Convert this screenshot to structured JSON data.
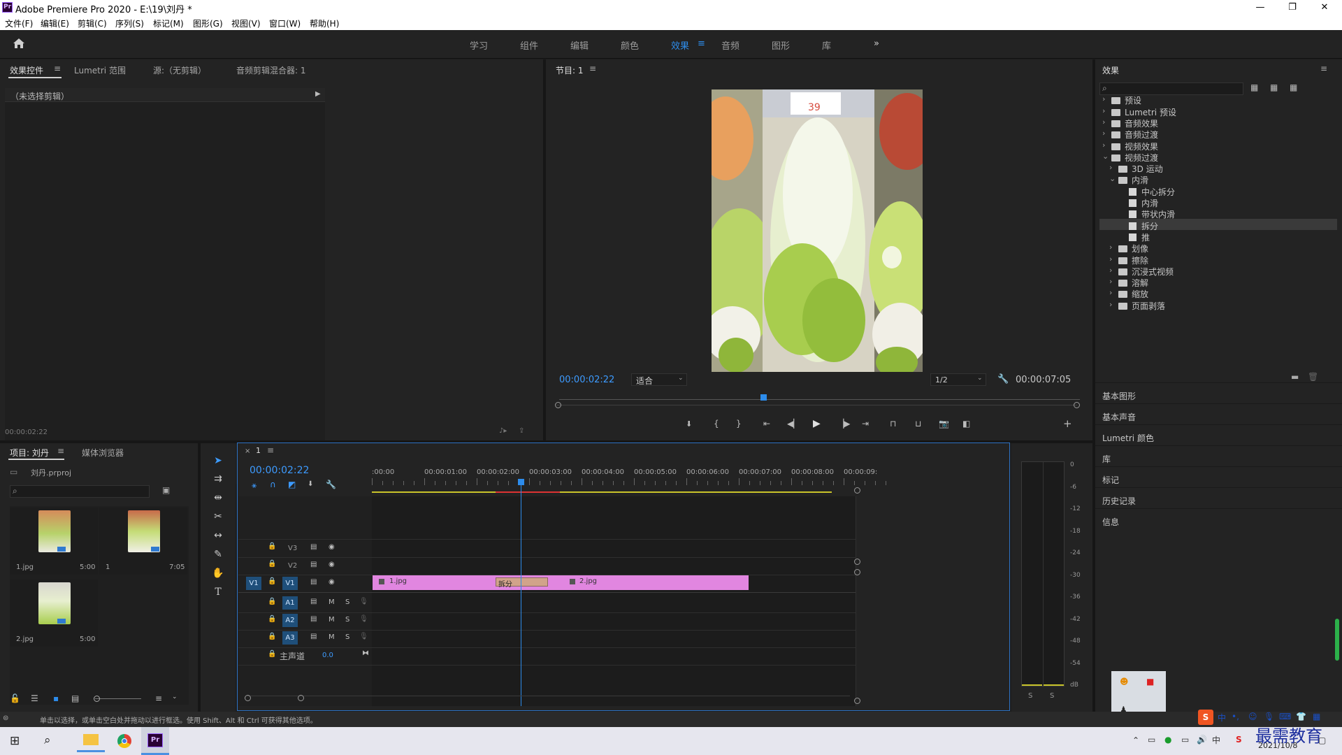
{
  "window": {
    "title": "Adobe Premiere Pro 2020 - E:\\19\\刘丹 *",
    "logo": "Pr",
    "controls": [
      "—",
      "❐",
      "✕"
    ]
  },
  "menu": [
    "文件(F)",
    "编辑(E)",
    "剪辑(C)",
    "序列(S)",
    "标记(M)",
    "图形(G)",
    "视图(V)",
    "窗口(W)",
    "帮助(H)"
  ],
  "workspaces": {
    "items": [
      "学习",
      "组件",
      "编辑",
      "颜色",
      "效果",
      "音频",
      "图形",
      "库"
    ],
    "active": "效果",
    "more": "»"
  },
  "effect_controls": {
    "tabs": [
      "效果控件",
      "Lumetri 范围",
      "源:（无剪辑）",
      "音频剪辑混合器: 1"
    ],
    "no_clip": "（未选择剪辑）",
    "timecode": "00:00:02:22"
  },
  "program": {
    "title": "节目: 1",
    "timecode": "00:00:02:22",
    "fit": "适合",
    "quality": "1/2",
    "duration": "00:00:07:05",
    "price_tag": "39"
  },
  "effects_panel": {
    "title": "效果",
    "tree": [
      {
        "label": "预设",
        "level": 0,
        "type": "folder",
        "open": false
      },
      {
        "label": "Lumetri 预设",
        "level": 0,
        "type": "folder",
        "open": false
      },
      {
        "label": "音频效果",
        "level": 0,
        "type": "folder",
        "open": false
      },
      {
        "label": "音频过渡",
        "level": 0,
        "type": "folder",
        "open": false
      },
      {
        "label": "视频效果",
        "level": 0,
        "type": "folder",
        "open": false
      },
      {
        "label": "视频过渡",
        "level": 0,
        "type": "folder",
        "open": true
      },
      {
        "label": "3D 运动",
        "level": 1,
        "type": "folder",
        "open": false
      },
      {
        "label": "内滑",
        "level": 1,
        "type": "folder",
        "open": true
      },
      {
        "label": "中心拆分",
        "level": 2,
        "type": "fx"
      },
      {
        "label": "内滑",
        "level": 2,
        "type": "fx"
      },
      {
        "label": "带状内滑",
        "level": 2,
        "type": "fx"
      },
      {
        "label": "拆分",
        "level": 2,
        "type": "fx",
        "selected": true
      },
      {
        "label": "推",
        "level": 2,
        "type": "fx"
      },
      {
        "label": "划像",
        "level": 1,
        "type": "folder",
        "open": false
      },
      {
        "label": "擦除",
        "level": 1,
        "type": "folder",
        "open": false
      },
      {
        "label": "沉浸式视频",
        "level": 1,
        "type": "folder",
        "open": false
      },
      {
        "label": "溶解",
        "level": 1,
        "type": "folder",
        "open": false
      },
      {
        "label": "缩放",
        "level": 1,
        "type": "folder",
        "open": false
      },
      {
        "label": "页面剥落",
        "level": 1,
        "type": "folder",
        "open": false
      }
    ],
    "sections": [
      "基本图形",
      "基本声音",
      "Lumetri 颜色",
      "库",
      "标记",
      "历史记录",
      "信息"
    ]
  },
  "project": {
    "tabs": [
      "项目: 刘丹",
      "媒体浏览器"
    ],
    "file": "刘丹.prproj",
    "items": [
      {
        "name": "1.jpg",
        "duration": "5:00"
      },
      {
        "name": "1",
        "duration": "7:05"
      },
      {
        "name": "2.jpg",
        "duration": "5:00"
      }
    ]
  },
  "timeline": {
    "tab": "1",
    "timecode": "00:00:02:22",
    "ruler": [
      ":00:00",
      "00:00:01:00",
      "00:00:02:00",
      "00:00:03:00",
      "00:00:04:00",
      "00:00:05:00",
      "00:00:06:00",
      "00:00:07:00",
      "00:00:08:00",
      "00:00:09:"
    ],
    "video_tracks": [
      "V3",
      "V2",
      "V1"
    ],
    "audio_tracks": [
      "A1",
      "A2",
      "A3"
    ],
    "source_patch": "V1",
    "mute": "M",
    "solo": "S",
    "master": {
      "label": "主声道",
      "value": "0.0"
    },
    "clips": [
      {
        "name": "1.jpg"
      },
      {
        "name": "2.jpg"
      }
    ],
    "transition": "拆分"
  },
  "meter": {
    "scale": [
      "0",
      "-6",
      "-12",
      "-18",
      "-24",
      "-30",
      "-36",
      "-42",
      "-48",
      "-54",
      "dB"
    ],
    "solo": [
      "S",
      "S"
    ]
  },
  "status": "单击以选择，或单击空白处并拖动以进行框选。使用 Shift、Alt 和 Ctrl 可获得其他选项。",
  "taskbar": {
    "ime": "中",
    "watermark": "最需教育",
    "date": "2021/10/8"
  }
}
